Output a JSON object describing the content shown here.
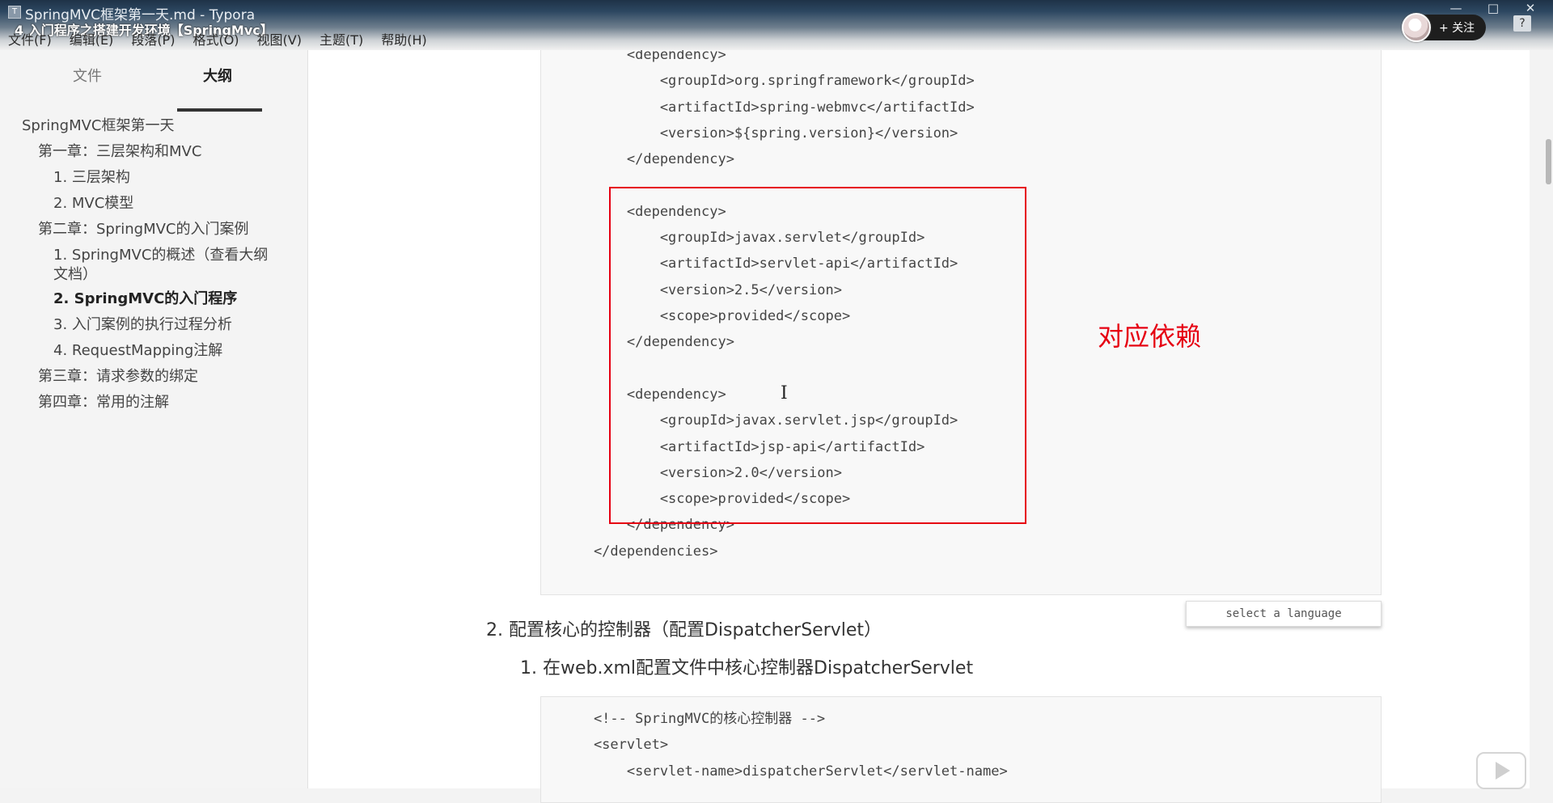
{
  "window": {
    "app_icon": "T",
    "title": "SpringMVC框架第一天.md - Typora",
    "video_title": "4 入门程序之搭建开发环境【SpringMvc】",
    "controls": [
      "—",
      "□",
      "✕"
    ]
  },
  "menubar": [
    "文件(F)",
    "编辑(E)",
    "段落(P)",
    "格式(O)",
    "视图(V)",
    "主题(T)",
    "帮助(H)"
  ],
  "overlay": {
    "follow_label": "+ 关注",
    "help_label": "?"
  },
  "sidebar": {
    "tabs": {
      "files": "文件",
      "outline": "大纲"
    },
    "outline": [
      {
        "label": "SpringMVC框架第一天",
        "level": 1
      },
      {
        "label": "第一章：三层架构和MVC",
        "level": 2
      },
      {
        "label": "1. 三层架构",
        "level": 3
      },
      {
        "label": "2. MVC模型",
        "level": 3
      },
      {
        "label": "第二章：SpringMVC的入门案例",
        "level": 2
      },
      {
        "label": "1. SpringMVC的概述（查看大纲",
        "level": 3
      },
      {
        "label": "文档）",
        "level": 3
      },
      {
        "label": "2. SpringMVC的入门程序",
        "level": 3,
        "active": true
      },
      {
        "label": "3. 入门案例的执行过程分析",
        "level": 3
      },
      {
        "label": "4. RequestMapping注解",
        "level": 3
      },
      {
        "label": "第三章：请求参数的绑定",
        "level": 2
      },
      {
        "label": "第四章：常用的注解",
        "level": 2
      }
    ]
  },
  "code_block_1": [
    "        <dependency>",
    "            <groupId>org.springframework</groupId>",
    "            <artifactId>spring-webmvc</artifactId>",
    "            <version>${spring.version}</version>",
    "        </dependency>",
    "",
    "        <dependency>",
    "            <groupId>javax.servlet</groupId>",
    "            <artifactId>servlet-api</artifactId>",
    "            <version>2.5</version>",
    "            <scope>provided</scope>",
    "        </dependency>",
    "",
    "        <dependency>",
    "            <groupId>javax.servlet.jsp</groupId>",
    "            <artifactId>jsp-api</artifactId>",
    "            <version>2.0</version>",
    "            <scope>provided</scope>",
    "        </dependency>",
    "    </dependencies>"
  ],
  "annotation": "对应依赖",
  "language_select": "select a language",
  "paragraphs": {
    "step2": "2. 配置核心的控制器（配置DispatcherServlet）",
    "step2_1": "1. 在web.xml配置文件中核心控制器DispatcherServlet"
  },
  "code_block_2": [
    "    <!-- SpringMVC的核心控制器 -->",
    "    <servlet>",
    "        <servlet-name>dispatcherServlet</servlet-name>"
  ],
  "cursor_glyph": "I",
  "colors": {
    "highlight": "#e60012",
    "code_bg": "#f8f8f8"
  }
}
